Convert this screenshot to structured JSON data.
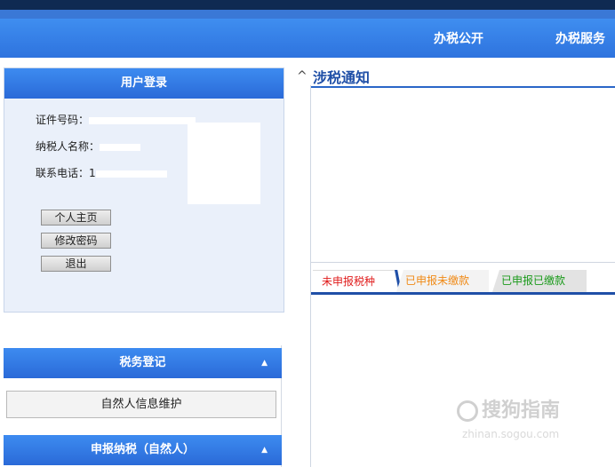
{
  "nav": {
    "items": [
      "办税公开",
      "办税服务"
    ]
  },
  "login": {
    "title": "用户登录",
    "id_label": "证件号码：",
    "name_label": "纳税人名称：",
    "phone_label": "联系电话：",
    "phone_partial": "1",
    "buttons": [
      "个人主页",
      "修改密码",
      "退出"
    ]
  },
  "sections": {
    "tax_registration": "税务登记",
    "tax_registration_item": "自然人信息维护",
    "tax_filing": "申报纳税（自然人）",
    "caret": "▲"
  },
  "notice": {
    "collapse_glyph": "^",
    "title": "涉税通知"
  },
  "tabs": [
    {
      "label": "未申报税种",
      "color": "#e01b1b"
    },
    {
      "label": "已申报未缴款",
      "color": "#f08a16"
    },
    {
      "label": "已申报已缴款",
      "color": "#1a9a1a"
    }
  ],
  "watermark": {
    "text": "搜狗指南",
    "sub": "zhinan.sogou.com"
  },
  "colors": {
    "nav_blue": "#3f8ef0",
    "header_dark": "#0f2a52",
    "accent_blue": "#1f4fa7"
  }
}
